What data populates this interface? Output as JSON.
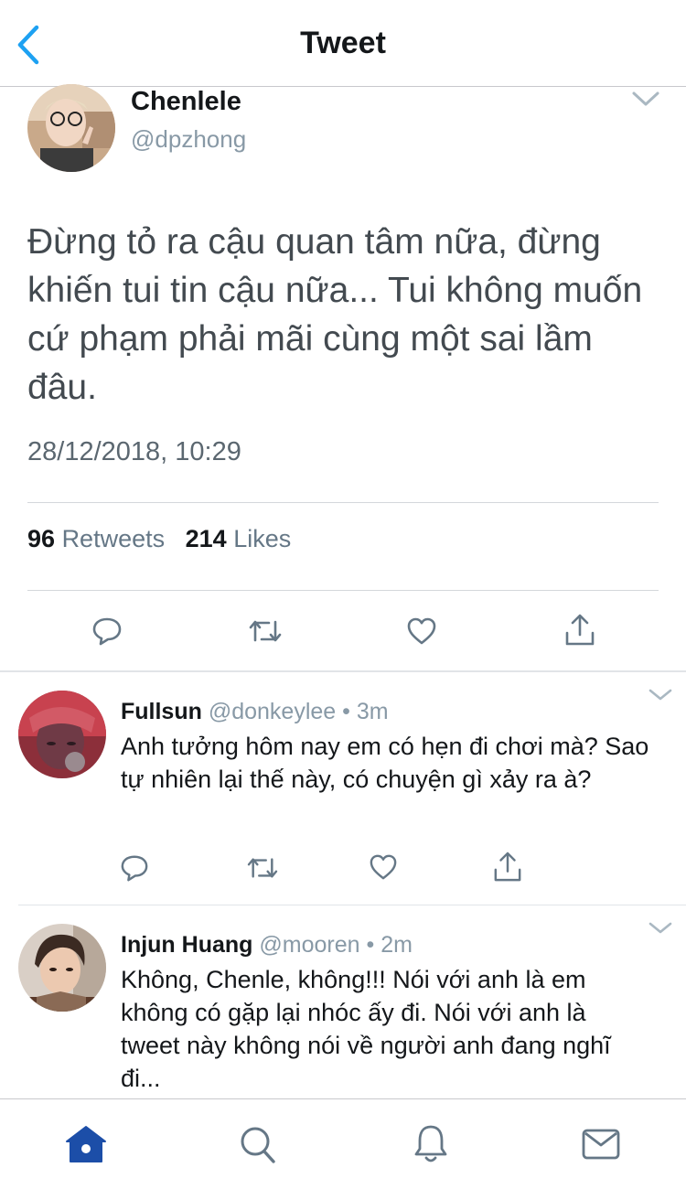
{
  "header": {
    "title": "Tweet",
    "back_icon": "chevron-left-icon"
  },
  "colors": {
    "accent": "#1da1f2",
    "tab_active": "#1c4ea8",
    "icon_gray": "#657786"
  },
  "main_tweet": {
    "name": "Chenlele",
    "handle": "@dpzhong",
    "text": "Đừng tỏ ra cậu quan tâm nữa, đừng khiến tui tin cậu nữa... Tui không muốn cứ phạm phải mãi cùng một sai lầm đâu.",
    "timestamp": "28/12/2018, 10:29",
    "retweets_count": "96",
    "retweets_label": "Retweets",
    "likes_count": "214",
    "likes_label": "Likes"
  },
  "replies": [
    {
      "name": "Fullsun",
      "handle": "@donkeylee",
      "time": "3m",
      "text": "Anh tưởng hôm nay em có hẹn đi chơi mà? Sao tự nhiên lại thế này, có chuyện gì xảy ra à?"
    },
    {
      "name": "Injun Huang",
      "handle": "@mooren",
      "time": "2m",
      "text": "Không, Chenle, không!!! Nói với anh là em không có gặp lại nhóc ấy đi. Nói với anh là tweet này không nói về người anh đang nghĩ đi..."
    }
  ],
  "tabbar": {
    "items": [
      {
        "name": "home",
        "icon": "home-icon",
        "active": true
      },
      {
        "name": "search",
        "icon": "search-icon",
        "active": false
      },
      {
        "name": "notifications",
        "icon": "bell-icon",
        "active": false
      },
      {
        "name": "messages",
        "icon": "mail-icon",
        "active": false
      }
    ]
  }
}
